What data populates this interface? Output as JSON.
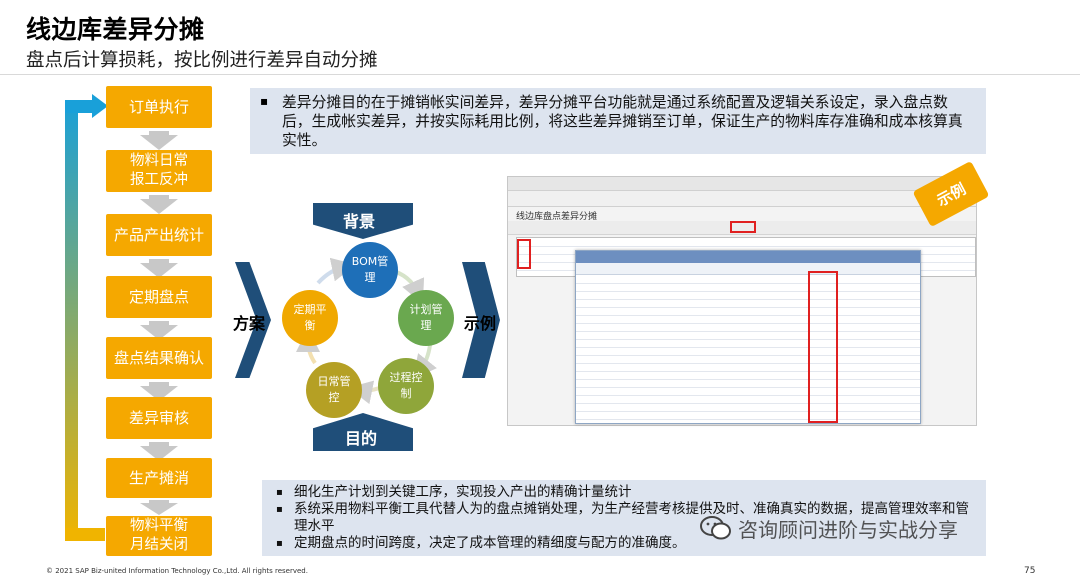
{
  "header": {
    "title": "线边库差异分摊",
    "subtitle": "盘点后计算损耗，按比例进行差异自动分摊"
  },
  "process_steps": [
    {
      "label": "订单执行"
    },
    {
      "label": "物料日常\n报工反冲"
    },
    {
      "label": "产品产出统计"
    },
    {
      "label": "定期盘点"
    },
    {
      "label": "盘点结果确认"
    },
    {
      "label": "差异审核"
    },
    {
      "label": "生产摊消"
    },
    {
      "label": "物料平衡\n月结关闭"
    }
  ],
  "description_top": "差异分摊目的在于摊销帐实间差异，差异分摊平台功能就是通过系统配置及逻辑关系设定，录入盘点数后，生成帐实差异，并按实际耗用比例，将这些差异摊销至订单，保证生产的物料库存准确和成本核算真实性。",
  "description_bottom": [
    "细化生产计划到关键工序，实现投入产出的精确计量统计",
    "系统采用物料平衡工具代替人为的盘点摊销处理，为生产经营考核提供及时、准确真实的数据，提高管理效率和管理水平",
    "定期盘点的时间跨度，决定了成本管理的精细度与配方的准确度。"
  ],
  "cycle": {
    "top_label": "背景",
    "bottom_label": "目的",
    "left_label": "方案",
    "right_label": "示例",
    "nodes": [
      {
        "label": "BOM管\n理",
        "color": "#1e6fb8"
      },
      {
        "label": "计划管\n理",
        "color": "#6aa84f"
      },
      {
        "label": "过程控\n制",
        "color": "#8fa63a"
      },
      {
        "label": "日常管\n控",
        "color": "#b5a024"
      },
      {
        "label": "定期平\n衡",
        "color": "#f0a800"
      }
    ]
  },
  "screenshot": {
    "window_title": "线边库盘点差异分摊",
    "badge": "示例"
  },
  "watermark": "咨询顾问进阶与实战分享",
  "footer": {
    "copyright": "© 2021 SAP Biz-united Information Technology Co.,Ltd.  All rights reserved.",
    "page_number": "75"
  },
  "colors": {
    "step_fill": "#f5a800",
    "chevron_fill": "#1f4e79",
    "desc_fill": "#dde4ef",
    "loop_top": "#19a0d9",
    "loop_bottom": "#f0b400"
  }
}
